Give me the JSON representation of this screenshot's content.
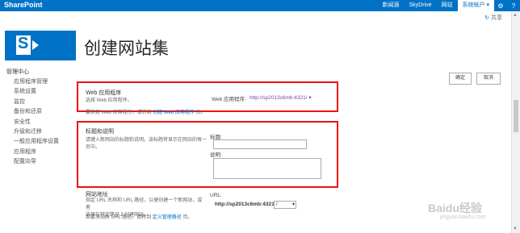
{
  "suitebar": {
    "brand": "SharePoint",
    "links": [
      "新闻源",
      "SkyDrive",
      "网站"
    ],
    "account": "系统帐户 ▾",
    "gear_glyph": "⚙",
    "help_glyph": "?"
  },
  "share": {
    "glyph": "↻",
    "label": "共享"
  },
  "focus_glyph": "▭",
  "logo": {
    "letter": "S"
  },
  "page": {
    "title": "创建网站集",
    "info_glyph": "i"
  },
  "quicklaunch": {
    "header": "管理中心",
    "items": [
      "应用程序管理",
      "系统设置",
      "监控",
      "备份和还原",
      "安全性",
      "升级和迁移",
      "一般应用程序设置",
      "应用程序",
      "配置向导"
    ]
  },
  "buttons": {
    "ok": "确定",
    "cancel": "取消"
  },
  "webapp": {
    "title": "Web 应用程序",
    "desc": "选择 Web 应用程序。",
    "field_label": "Web 应用程序:",
    "value": "http://sp2013c6mb:4321/",
    "dropdown_glyph": "▾",
    "hint_prefix": "要新建 Web 应用程序，请转到",
    "hint_link": "创建 Web 应用程序",
    "hint_suffix": "页。"
  },
  "titledesc": {
    "title": "标题和说明",
    "desc1": "请键入新网站的标题和说明。该标题将显示在网站的每一",
    "desc2": "页中。",
    "title_label": "标题:",
    "desc_label": "说明:"
  },
  "url": {
    "title": "网站地址",
    "desc1": "指定 URL 名称和 URL 路径，以便创建一个新网站，或者",
    "desc2": "选择在特定路径上创建网站。",
    "hint_prefix": "若要添加新 URL 路径，请转到",
    "hint_link": "定义管理路径",
    "hint_suffix": "页。",
    "label": "URL:",
    "base": "http://sp2013c6mb:4321",
    "path": "/",
    "dropdown_glyph": "▾"
  },
  "scrollbar": {
    "up_glyph": "▲",
    "down_glyph": "▼"
  },
  "watermark": {
    "text": "Baidu经验",
    "sub": "jingyan.baidu.com"
  },
  "colors": {
    "suitebar": "#0072c6",
    "highlight": "#ee1111",
    "link": "#0072c6"
  }
}
